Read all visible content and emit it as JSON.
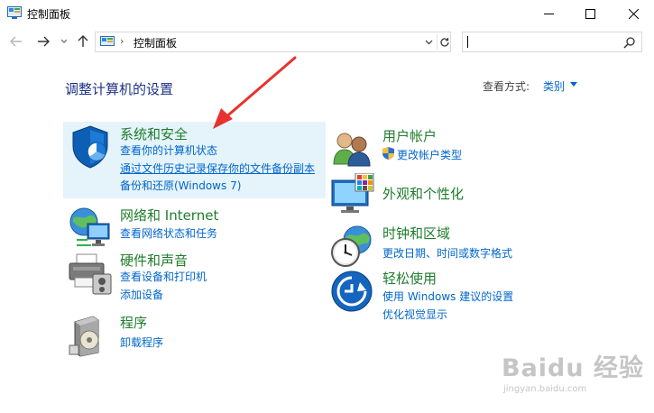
{
  "window": {
    "title": "控制面板"
  },
  "nav": {
    "breadcrumb": "控制面板",
    "search_value": ""
  },
  "main": {
    "heading": "调整计算机的设置",
    "view_by_label": "查看方式:",
    "view_by_value": "类别"
  },
  "categories": {
    "system_security": {
      "title": "系统和安全",
      "links": [
        "查看你的计算机状态",
        "通过文件历史记录保存你的文件备份副本",
        "备份和还原(Windows 7)"
      ]
    },
    "network": {
      "title": "网络和 Internet",
      "links": [
        "查看网络状态和任务"
      ]
    },
    "hardware": {
      "title": "硬件和声音",
      "links": [
        "查看设备和打印机",
        "添加设备"
      ]
    },
    "programs": {
      "title": "程序",
      "links": [
        "卸载程序"
      ]
    },
    "user_accounts": {
      "title": "用户帐户",
      "links": [
        "更改帐户类型"
      ]
    },
    "appearance": {
      "title": "外观和个性化",
      "links": []
    },
    "clock": {
      "title": "时钟和区域",
      "links": [
        "更改日期、时间或数字格式"
      ]
    },
    "ease": {
      "title": "轻松使用",
      "links": [
        "使用 Windows 建议的设置",
        "优化视觉显示"
      ]
    }
  },
  "watermark": {
    "main": "Baidu 经验",
    "sub": "jingyan.baidu.com"
  },
  "colors": {
    "heading": "#1e3287",
    "category_title": "#1e7d2b",
    "link": "#0066cc",
    "highlight": "#e5f3fb",
    "annotation_arrow": "#e8322f"
  },
  "icons": {
    "app": "control-panel-icon",
    "back": "back-arrow-icon",
    "forward": "forward-arrow-icon",
    "up": "up-arrow-icon",
    "search": "search-icon",
    "refresh": "refresh-icon"
  }
}
